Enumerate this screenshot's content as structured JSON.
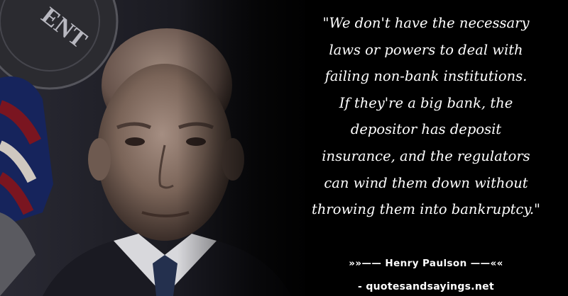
{
  "quote": {
    "lines": [
      "\"We don't have the necessary",
      "laws or powers to deal with",
      "failing non-bank institutions.",
      "If they're a big bank, the",
      "depositor has deposit",
      "insurance, and the regulators",
      "can wind them down without",
      "throwing them into bankruptcy.\""
    ]
  },
  "author": "»»—— Henry Paulson ——««",
  "site": "- quotesandsayings.net",
  "photo": {
    "seal_text": "ENT"
  },
  "colors": {
    "background": "#000000",
    "text": "#ffffff",
    "flag_red": "#7a1520",
    "flag_blue": "#16245c"
  }
}
